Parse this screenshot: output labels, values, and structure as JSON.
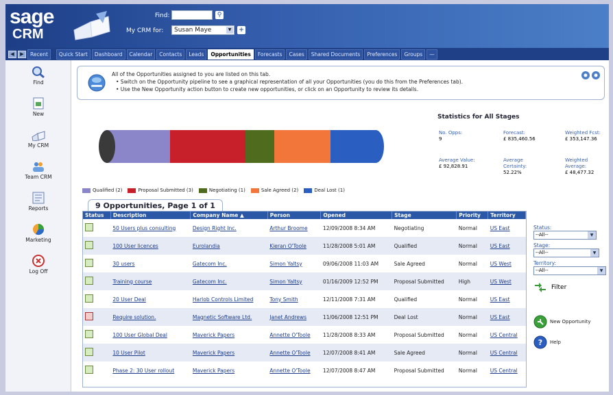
{
  "header": {
    "logo_top": "sage",
    "logo_bottom": "CRM",
    "find_label": "Find:",
    "mycrm_label": "My CRM for:",
    "mycrm_value": "Susan Maye"
  },
  "nav": {
    "recent": "Recent",
    "tabs": [
      "Quick Start",
      "Dashboard",
      "Calendar",
      "Contacts",
      "Leads",
      "Opportunities",
      "Forecasts",
      "Cases",
      "Shared Documents",
      "Preferences",
      "Groups",
      "—"
    ],
    "active_tab": "Opportunities"
  },
  "sidebar": [
    {
      "label": "Find",
      "icon": "magnifier-icon"
    },
    {
      "label": "New",
      "icon": "new-document-icon"
    },
    {
      "label": "My CRM",
      "icon": "my-crm-book-icon"
    },
    {
      "label": "Team CRM",
      "icon": "team-icon"
    },
    {
      "label": "Reports",
      "icon": "reports-icon"
    },
    {
      "label": "Marketing",
      "icon": "marketing-icon"
    },
    {
      "label": "Log Off",
      "icon": "log-off-icon"
    }
  ],
  "info": {
    "line1": "All of the Opportunities assigned to you are listed on this tab.",
    "line2": "•  Switch on the Opportunity pipeline to see a graphical representation of all your Opportunities (you do this from the Preferences tab).",
    "line3": "•  Use the New Opportunity action button to create new opportunities, or click on an Opportunity to review its details."
  },
  "pipeline": {
    "stages": [
      {
        "label": "Qualified (2)",
        "color": "#8b85c9"
      },
      {
        "label": "Proposal Submitted (3)",
        "color": "#c8202a"
      },
      {
        "label": "Negotiating (1)",
        "color": "#4e6b1e"
      },
      {
        "label": "Sale Agreed (2)",
        "color": "#f2763a"
      },
      {
        "label": "Deal Lost (1)",
        "color": "#2a5ec0"
      }
    ]
  },
  "stats": {
    "title": "Statistics for All Stages",
    "no_opps_label": "No. Opps:",
    "no_opps": "9",
    "forecast_label": "Forecast:",
    "forecast": "£ 835,460.56",
    "weighted_fcst_label": "Weighted Fcst:",
    "weighted_fcst": "£ 353,147.36",
    "avg_value_label": "Average Value:",
    "avg_value": "£ 92,828.91",
    "avg_certainty_label": "Average Certainty:",
    "avg_certainty": "52.22%",
    "weighted_avg_label": "Weighted Average:",
    "weighted_avg": "£ 48,477.32"
  },
  "list": {
    "title": "9 Opportunities, Page 1 of 1",
    "columns": [
      "Status",
      "Description",
      "Company Name ▲",
      "Person",
      "Opened",
      "Stage",
      "Priority",
      "Territory"
    ],
    "rows": [
      [
        "",
        "50 Users plus consulting",
        "Design Right Inc.",
        "Arthur Broome",
        "12/09/2008 8:34 AM",
        "Negotiating",
        "Normal",
        "US East"
      ],
      [
        "",
        "100 User licences",
        "Eurolandia",
        "Kieran O'Toole",
        "11/28/2008 5:01 AM",
        "Qualified",
        "Normal",
        "US East"
      ],
      [
        "",
        "30 users",
        "Gatecom Inc.",
        "Simon Yaltsy",
        "09/06/2008 11:03 AM",
        "Sale Agreed",
        "Normal",
        "US West"
      ],
      [
        "",
        "Training course",
        "Gatecom Inc.",
        "Simon Yaltsy",
        "01/16/2009 12:52 PM",
        "Proposal Submitted",
        "High",
        "US West"
      ],
      [
        "",
        "20 User Deal",
        "Harlob Controls Limited",
        "Tony Smith",
        "12/11/2008 7:31 AM",
        "Qualified",
        "Normal",
        "US East"
      ],
      [
        "lost",
        "Require solution.",
        "Magnetic Software Ltd.",
        "Janet Andrews",
        "11/06/2008 12:51 PM",
        "Deal Lost",
        "Normal",
        "US East"
      ],
      [
        "",
        "100 User Global Deal",
        "Maverick Papers",
        "Annette O'Toole",
        "11/28/2008 8:33 AM",
        "Proposal Submitted",
        "Normal",
        "US Central"
      ],
      [
        "",
        "10 User Pilot",
        "Maverick Papers",
        "Annette O'Toole",
        "12/07/2008 8:41 AM",
        "Sale Agreed",
        "Normal",
        "US Central"
      ],
      [
        "",
        "Phase 2: 30 User rollout",
        "Maverick Papers",
        "Annette O'Toole",
        "12/07/2008 8:47 AM",
        "Proposal Submitted",
        "Normal",
        "US Central"
      ]
    ]
  },
  "filters": {
    "status_label": "Status:",
    "stage_label": "Stage:",
    "territory_label": "Territory:",
    "all_value": "--All--",
    "filter_button": "Filter"
  },
  "actions": {
    "new_opportunity": "New Opportunity",
    "help": "Help"
  }
}
